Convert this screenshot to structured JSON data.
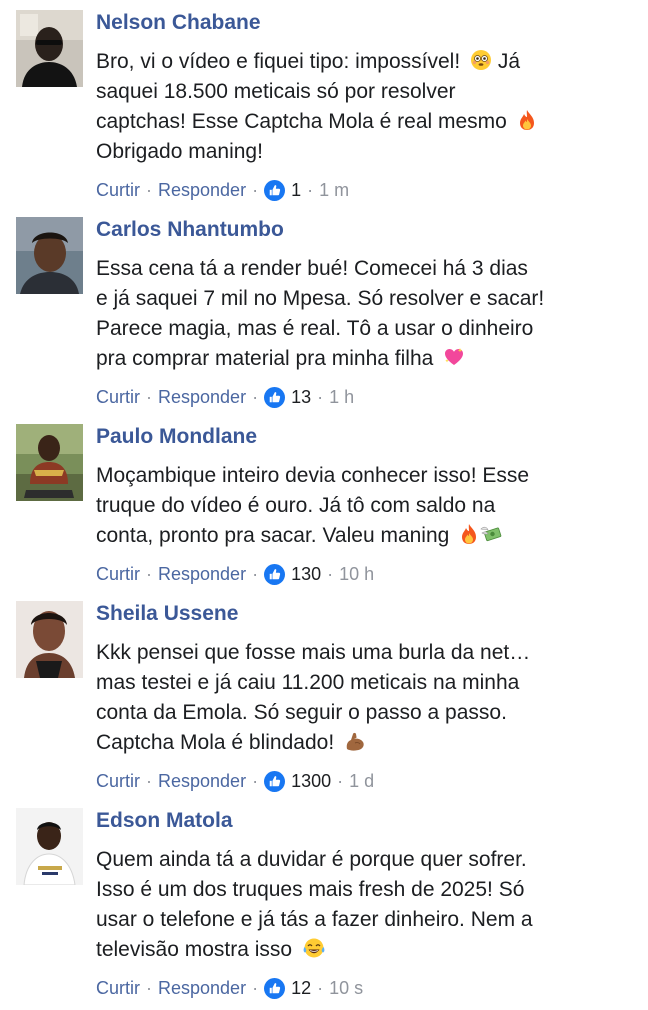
{
  "actions": {
    "like_label": "Curtir",
    "reply_label": "Responder",
    "separator": "·"
  },
  "colors": {
    "author_name": "#3b5897",
    "action_link": "#4b67a1",
    "meta_text": "#90949c",
    "like_badge": "#1877f2",
    "body_text": "#1c1e21"
  },
  "comments": [
    {
      "author": "Nelson Chabane",
      "lines": [
        "Bro, vi o vídeo e fiquei tipo: impossível!",
        "saquei 18.500 meticais só por resolver",
        "captchas! Esse Captcha Mola é real mesmo",
        "Obrigado maning!"
      ],
      "line1_suffix": "Já",
      "emojis": [
        "flushed-face-emoji",
        "fire-emoji"
      ],
      "likes": "1",
      "time": "1 m"
    },
    {
      "author": "Carlos Nhantumbo",
      "lines": [
        "Essa cena tá a render bué! Comecei há 3 dias",
        "e já saquei 7 mil no Mpesa. Só resolver e sacar!",
        "Parece magia, mas é real. Tô a usar o dinheiro",
        "pra comprar material pra minha filha"
      ],
      "emojis": [
        "sparkling-heart-emoji"
      ],
      "likes": "13",
      "time": "1 h"
    },
    {
      "author": "Paulo Mondlane",
      "lines": [
        "Moçambique inteiro devia conhecer isso! Esse",
        "truque do vídeo é ouro. Já tô com saldo na",
        "conta, pronto pra sacar. Valeu maning"
      ],
      "emojis": [
        "fire-emoji",
        "money-with-wings-emoji"
      ],
      "likes": "130",
      "time": "10 h"
    },
    {
      "author": "Sheila Ussene",
      "lines": [
        "Kkk pensei que fosse mais uma burla da net…",
        "mas testei e já caiu 11.200 meticais na minha",
        "conta da Emola. Só seguir o passo a passo.",
        "Captcha Mola é blindado!"
      ],
      "emojis": [
        "flexed-biceps-emoji"
      ],
      "likes": "1300",
      "time": "1 d"
    },
    {
      "author": "Edson Matola",
      "lines": [
        "Quem ainda tá a duvidar é porque quer sofrer.",
        "Isso é um dos truques mais fresh de 2025! Só",
        "usar o telefone e já tás a fazer dinheiro. Nem a",
        "televisão mostra isso"
      ],
      "emojis": [
        "tears-of-joy-emoji"
      ],
      "likes": "12",
      "time": "10 s"
    }
  ]
}
